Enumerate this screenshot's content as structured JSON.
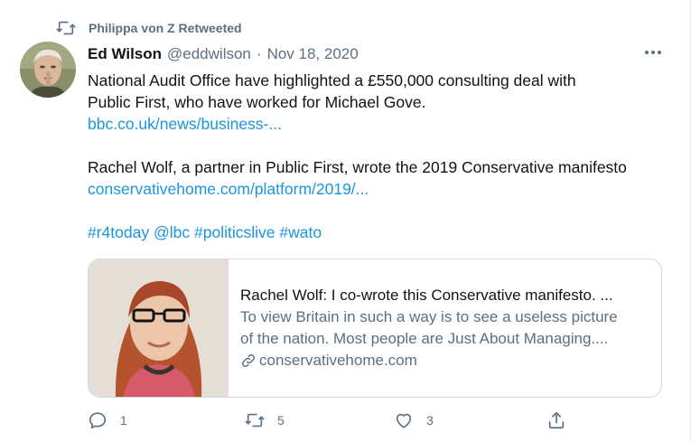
{
  "retweet_context": {
    "text": "Philippa von Z Retweeted",
    "icon": "retweet-icon"
  },
  "author": {
    "name": "Ed Wilson",
    "handle": "@eddwilson",
    "separator": "·",
    "date": "Nov 18, 2020"
  },
  "tweet": {
    "line1": "National Audit Office have highlighted a £550,000 consulting deal with",
    "line2": "Public First, who have worked for Michael Gove.",
    "link1": "bbc.co.uk/news/business-...",
    "line3": "Rachel Wolf, a partner in Public First, wrote the 2019 Conservative manifesto",
    "link2": "conservativehome.com/platform/2019/...",
    "hashtags": [
      "#r4today",
      "@lbc",
      "#politicslive",
      "#wato"
    ]
  },
  "card": {
    "title": "Rachel Wolf: I co-wrote this Conservative manifesto. ...",
    "desc_line1": "To view Britain in such a way is to see a useless picture",
    "desc_line2": "of the nation. Most people are Just About Managing....",
    "domain": "conservativehome.com"
  },
  "actions": {
    "reply_count": "1",
    "retweet_count": "5",
    "like_count": "3"
  },
  "colors": {
    "link": "#1b95e0",
    "secondary_text": "#5b7083",
    "primary_text": "#0f1419",
    "border": "#cfd9de"
  }
}
